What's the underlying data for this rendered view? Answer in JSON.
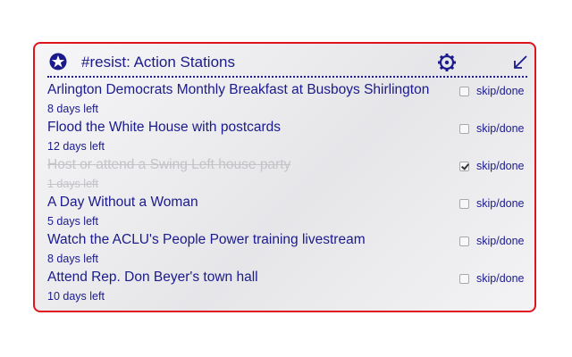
{
  "header": {
    "title": "#resist: Action Stations",
    "star_icon": "star-icon",
    "gear_icon": "gear-icon",
    "collapse_icon": "collapse-arrow-icon"
  },
  "colors": {
    "accent": "#1a1a8c",
    "border": "#e0141e",
    "done_text": "#c3c3c8"
  },
  "items": [
    {
      "title": "Arlington Democrats Monthly Breakfast at Busboys Shirlington",
      "days": "8 days left",
      "toggle_label": "skip/done",
      "done": false
    },
    {
      "title": "Flood the White House with postcards",
      "days": "12 days left",
      "toggle_label": "skip/done",
      "done": false
    },
    {
      "title": "Host or attend a Swing Left house party",
      "days": "1 days left",
      "toggle_label": "skip/done",
      "done": true
    },
    {
      "title": "A Day Without a Woman",
      "days": "5 days left",
      "toggle_label": "skip/done",
      "done": false
    },
    {
      "title": "Watch the ACLU's People Power training livestream",
      "days": "8 days left",
      "toggle_label": "skip/done",
      "done": false
    },
    {
      "title": "Attend Rep. Don Beyer's town hall",
      "days": "10 days left",
      "toggle_label": "skip/done",
      "done": false
    }
  ]
}
